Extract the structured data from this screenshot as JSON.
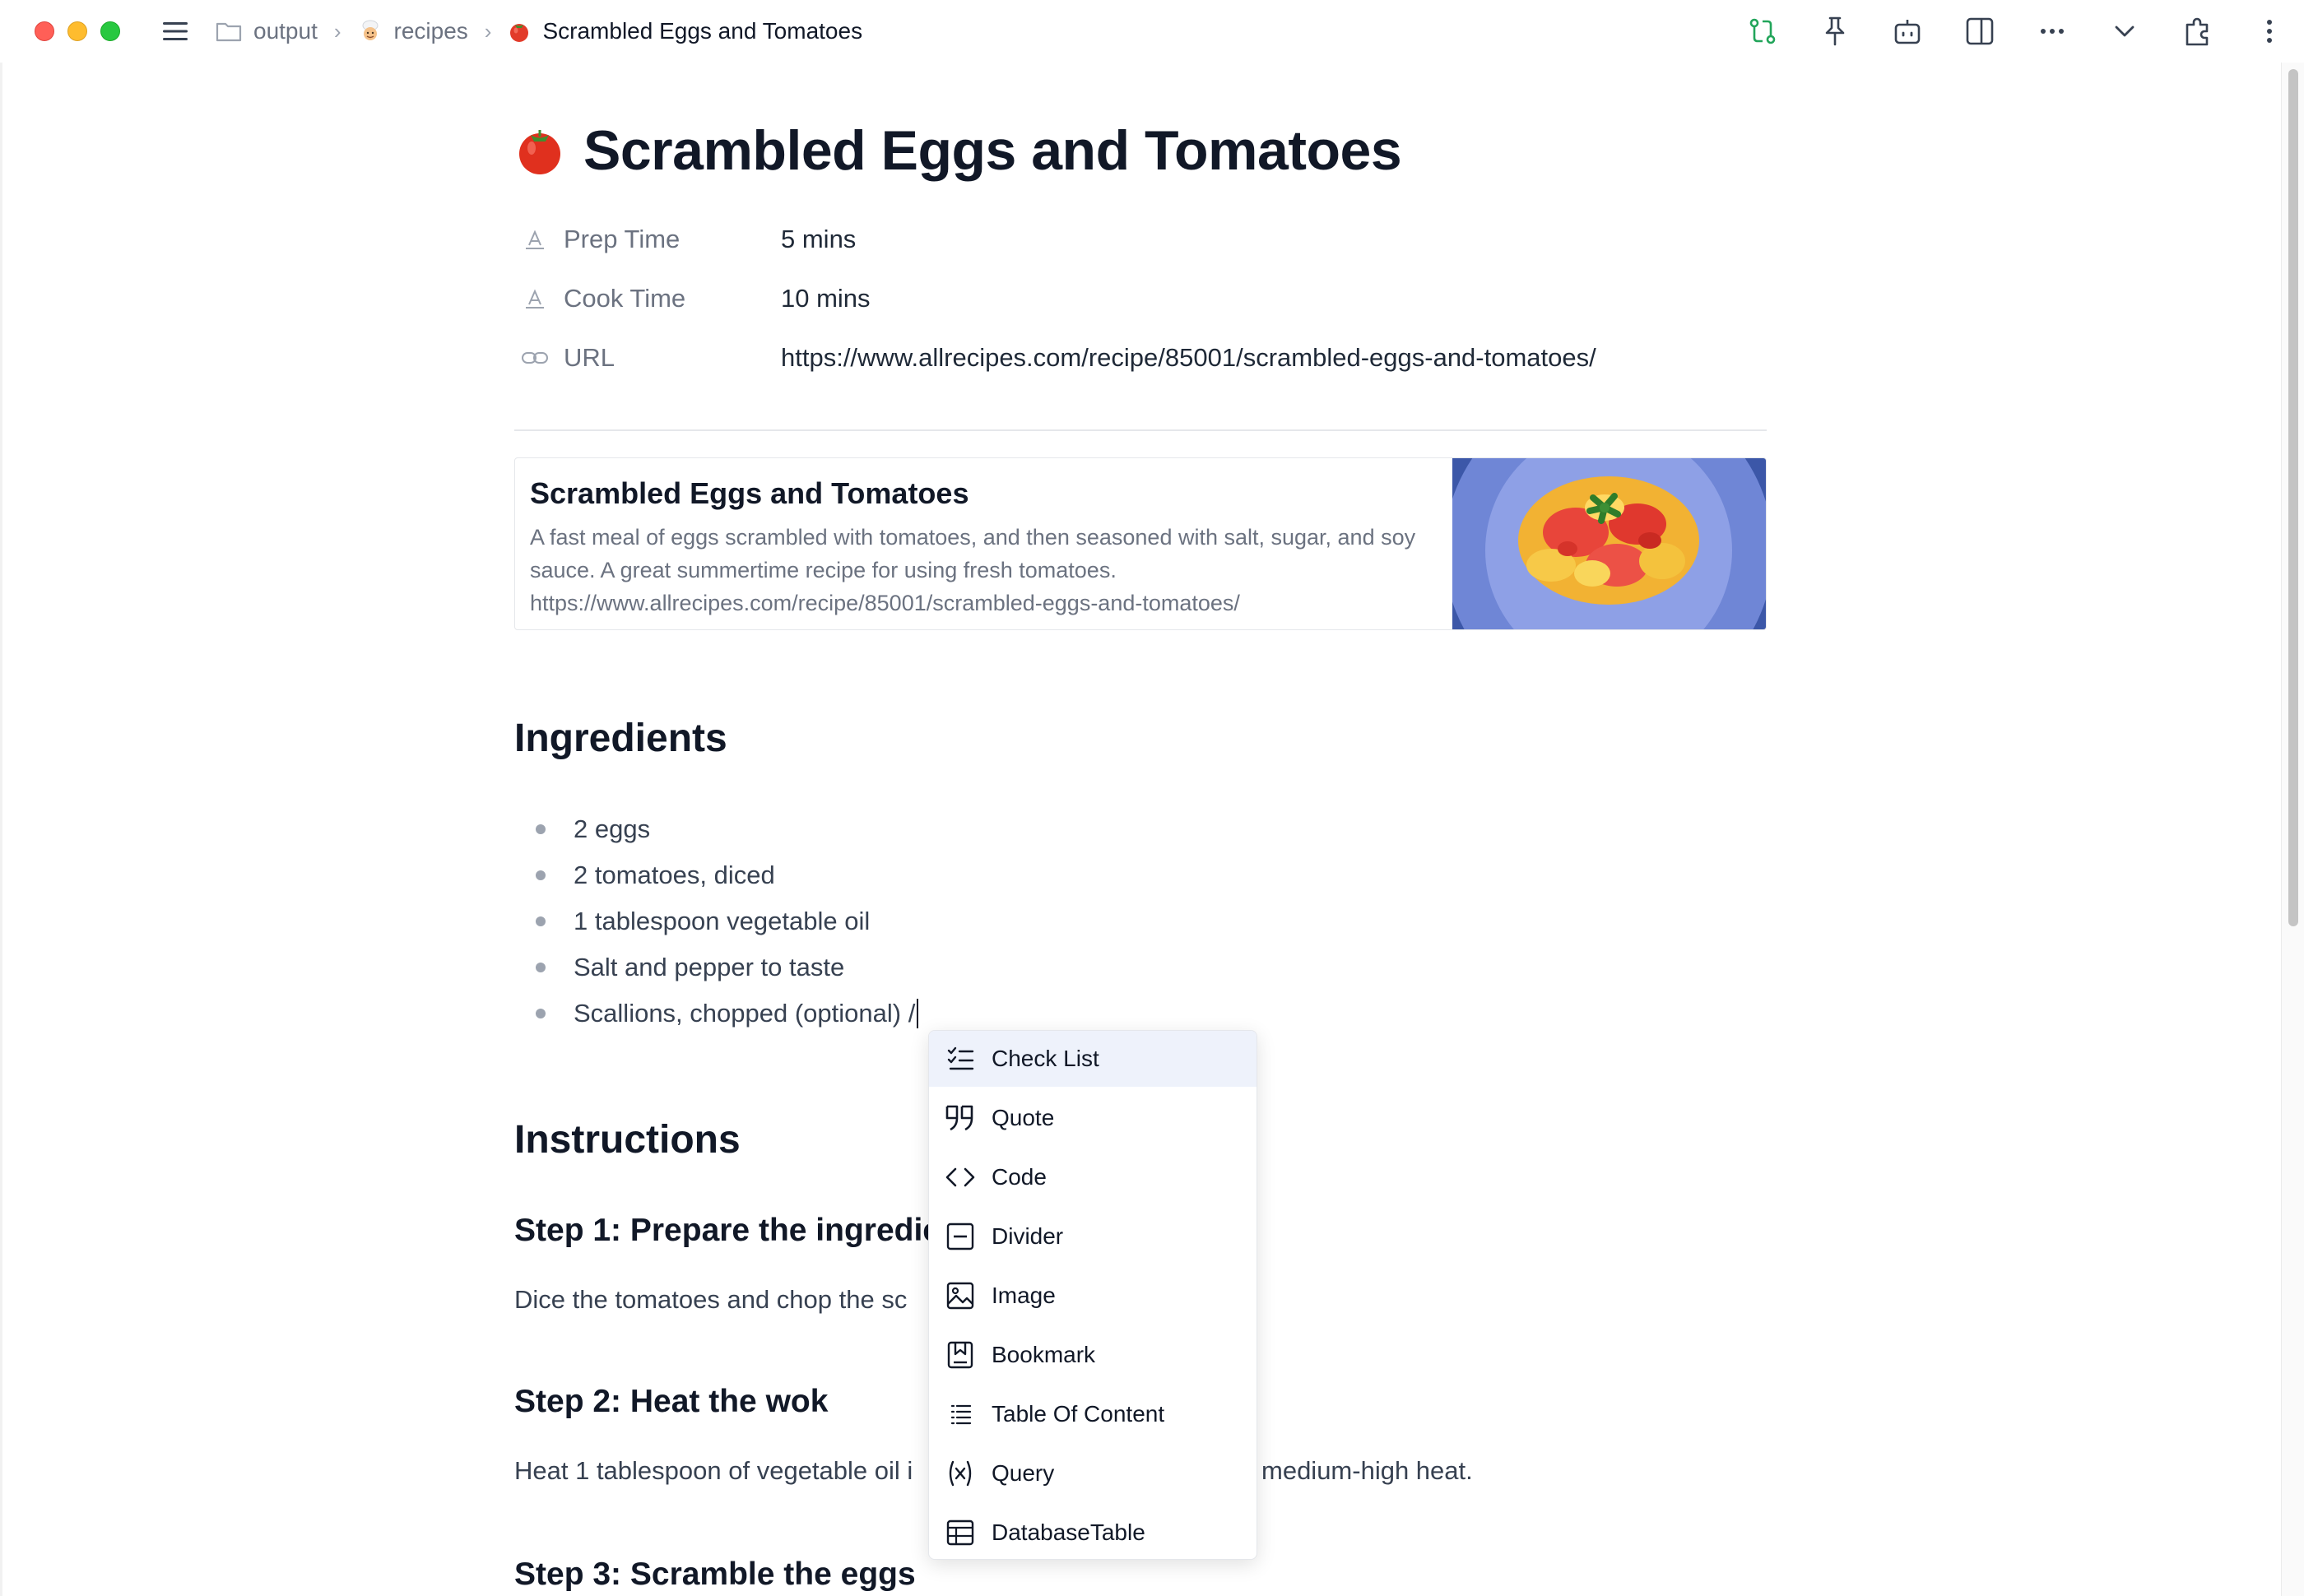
{
  "window": {
    "breadcrumb": {
      "items": [
        {
          "label": "output"
        },
        {
          "label": "recipes"
        },
        {
          "label": "Scrambled Eggs and Tomatoes"
        }
      ],
      "separator": "›"
    }
  },
  "page": {
    "title": "Scrambled Eggs and Tomatoes",
    "properties": [
      {
        "name": "Prep Time",
        "value": "5 mins",
        "icon": "text-property-icon"
      },
      {
        "name": "Cook Time",
        "value": "10 mins",
        "icon": "text-property-icon"
      },
      {
        "name": "URL",
        "value": "https://www.allrecipes.com/recipe/85001/scrambled-eggs-and-tomatoes/",
        "icon": "link-icon"
      }
    ],
    "bookmark": {
      "title": "Scrambled Eggs and Tomatoes",
      "description": "A fast meal of eggs scrambled with tomatoes, and then seasoned with salt, sugar, and soy sauce. A great summertime recipe for using fresh tomatoes.",
      "url": "https://www.allrecipes.com/recipe/85001/scrambled-eggs-and-tomatoes/"
    },
    "ingredients_heading": "Ingredients",
    "ingredients": [
      "2 eggs",
      "2 tomatoes, diced",
      "1 tablespoon vegetable oil",
      "Salt and pepper to taste",
      "Scallions, chopped (optional) /"
    ],
    "instructions_heading": "Instructions",
    "steps": [
      {
        "title": "Step 1: Prepare the ingredie",
        "text": "Dice the tomatoes and chop the sc"
      },
      {
        "title": "Step 2: Heat the wok",
        "text_before": "Heat 1 tablespoon of vegetable oil i",
        "text_after": "medium-high heat."
      },
      {
        "title": "Step 3: Scramble the eggs"
      }
    ]
  },
  "slash_menu": {
    "items": [
      {
        "label": "Check List",
        "icon": "checklist-icon"
      },
      {
        "label": "Quote",
        "icon": "quote-icon"
      },
      {
        "label": "Code",
        "icon": "code-icon"
      },
      {
        "label": "Divider",
        "icon": "divider-icon"
      },
      {
        "label": "Image",
        "icon": "image-icon"
      },
      {
        "label": "Bookmark",
        "icon": "bookmark-icon"
      },
      {
        "label": "Table Of Content",
        "icon": "toc-icon"
      },
      {
        "label": "Query",
        "icon": "query-icon"
      },
      {
        "label": "DatabaseTable",
        "icon": "table-icon"
      }
    ],
    "selected_index": 0
  },
  "colors": {
    "accent_sync": "#22a55a",
    "menu_active_bg": "#eef2fb",
    "text_primary": "#111827",
    "text_muted": "#6b7280"
  }
}
